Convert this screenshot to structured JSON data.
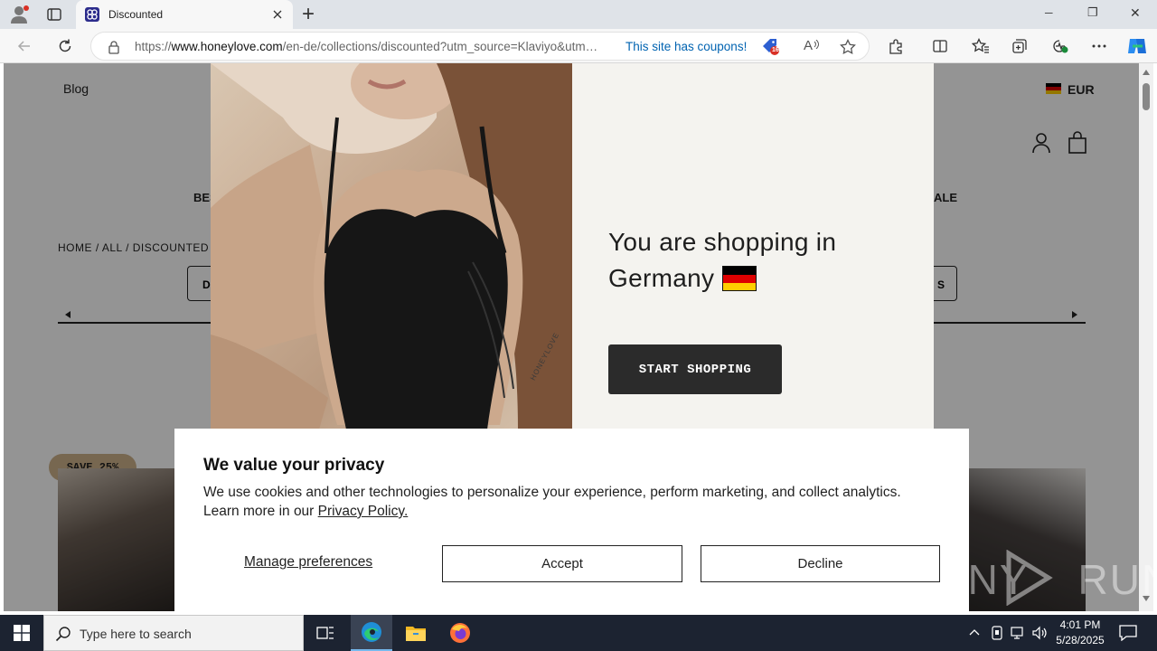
{
  "browser": {
    "tab_title": "Discounted",
    "new_tab": "+",
    "url_prefix": "https://",
    "url_domain": "www.honeylove.com",
    "url_path": "/en-de/collections/discounted?utm_source=Klaviyo&utm…",
    "coupons_text": "This site has coupons!",
    "coupon_badge": "16",
    "read_aloud": "A",
    "window_controls": {
      "minimize": "─",
      "restore": "❐",
      "close": "✕"
    }
  },
  "site": {
    "blog_link": "Blog",
    "currency": "EUR",
    "nav_left_fragment": "BES",
    "nav_right_fragment": "ALE",
    "breadcrumb": "HOME / ALL / DISCOUNTED",
    "filter_left_fragment": "D",
    "filter_right_fragment": "S",
    "product_badge": "SAVE 25%"
  },
  "modal": {
    "heading_line1": "You are shopping in",
    "heading_line2": "Germany",
    "cta": "START SHOPPING",
    "photo_text": "HONEYLOVE"
  },
  "cookie": {
    "title": "We value your privacy",
    "body": "We use cookies and other technologies to personalize your experience, perform marketing, and collect analytics. Learn more in our",
    "policy_link": "Privacy Policy.",
    "manage": "Manage preferences",
    "accept": "Accept",
    "decline": "Decline"
  },
  "taskbar": {
    "search_placeholder": "Type here to search",
    "time": "4:01 PM",
    "date": "5/28/2025"
  },
  "watermark": "ANY RUN",
  "colors": {
    "accent_blue": "#0063b1",
    "cta_dark": "#2b2b2b",
    "badge_tan": "#cdb18a",
    "taskbar": "#1c2331"
  },
  "icons": [
    "profile-icon",
    "tab-actions-icon",
    "tab-favicon",
    "close-tab-icon",
    "back-icon",
    "refresh-icon",
    "lock-icon",
    "coupon-icon",
    "read-aloud-icon",
    "favorite-icon",
    "extensions-icon",
    "split-screen-icon",
    "favorites-icon",
    "collections-icon",
    "performance-icon",
    "more-icon",
    "copilot-icon",
    "flag-de-icon",
    "account-icon",
    "bag-icon",
    "windows-start-icon",
    "search-icon",
    "task-view-icon",
    "edge-icon",
    "file-explorer-icon",
    "firefox-icon"
  ]
}
